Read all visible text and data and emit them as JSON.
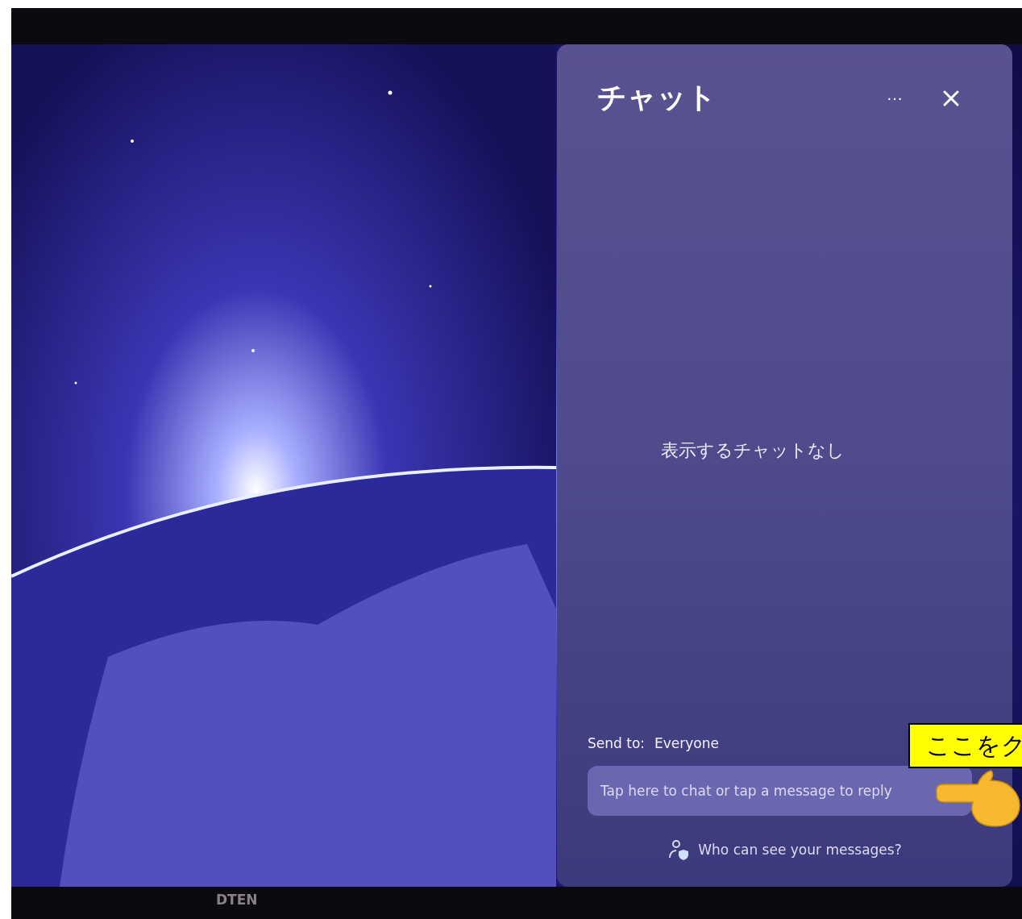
{
  "chat_panel": {
    "title": "チャット",
    "more_button": "···",
    "empty_message": "表示するチャットなし",
    "send_to": {
      "label": "Send to:",
      "value": "Everyone"
    },
    "message_field": {
      "placeholder": "Tap here to chat or tap a message to reply"
    },
    "privacy_link": "Who can see your messages?"
  },
  "callout": {
    "text": "ここをク"
  },
  "bezel_logo": "DTEN"
}
